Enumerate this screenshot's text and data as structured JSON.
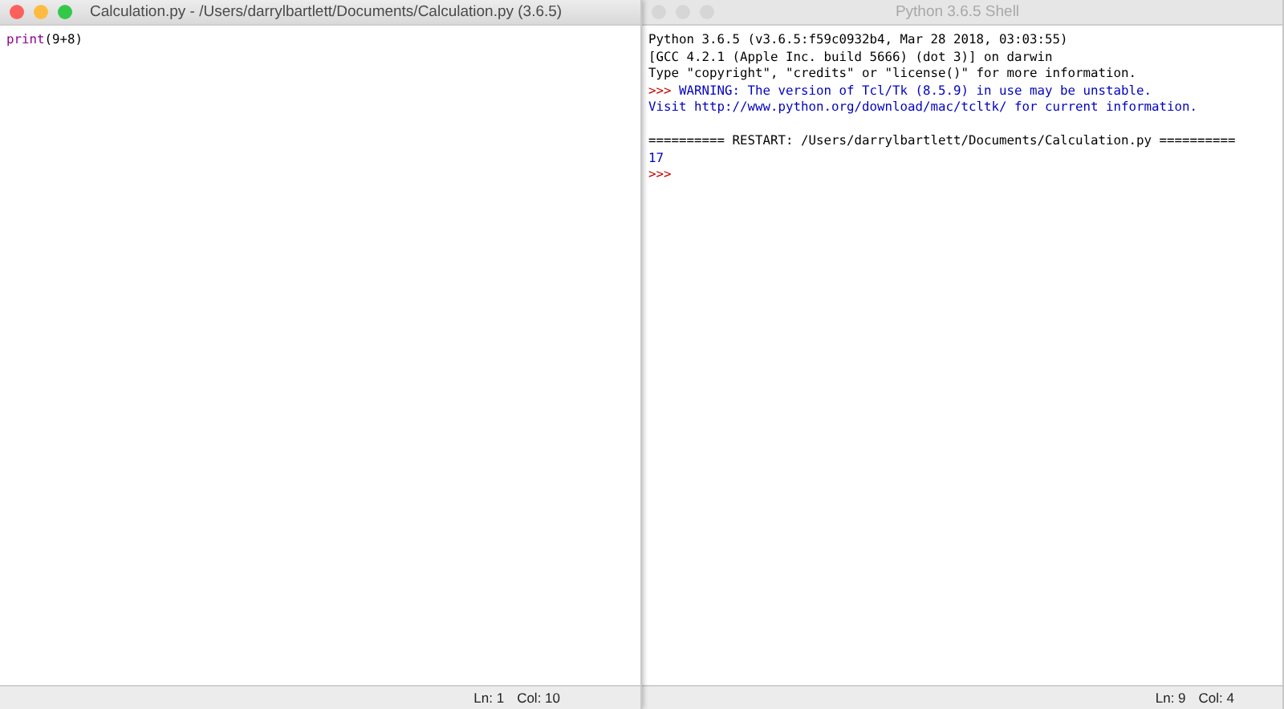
{
  "editor": {
    "title": "Calculation.py - /Users/darrylbartlett/Documents/Calculation.py (3.6.5)",
    "active": true,
    "lines": [
      [
        {
          "text": "print",
          "kind": "builtin"
        },
        {
          "text": "(9+8)",
          "kind": "plain"
        }
      ]
    ],
    "status": [
      "Ln: 1",
      "Col: 10"
    ]
  },
  "shell": {
    "title": "Python 3.6.5 Shell",
    "active": false,
    "lines": [
      {
        "gap_before": false,
        "segments": [
          {
            "text": "Python 3.6.5 (v3.6.5:f59c0932b4, Mar 28 2018, 03:03:55)",
            "kind": "plain"
          }
        ]
      },
      {
        "gap_before": false,
        "segments": [
          {
            "text": "[GCC 4.2.1 (Apple Inc. build 5666) (dot 3)] on darwin",
            "kind": "plain"
          }
        ]
      },
      {
        "gap_before": false,
        "segments": [
          {
            "text": "Type \"copyright\", \"credits\" or \"license()\" for more information.",
            "kind": "plain"
          }
        ]
      },
      {
        "gap_before": false,
        "segments": [
          {
            "text": ">>>",
            "kind": "prompt"
          },
          {
            "text": " WARNING: The version of Tcl/Tk (8.5.9) in use may be unstable.",
            "kind": "output"
          }
        ]
      },
      {
        "gap_before": false,
        "segments": [
          {
            "text": "Visit http://www.python.org/download/mac/tcltk/ for current information.",
            "kind": "output"
          }
        ]
      },
      {
        "gap_before": true,
        "segments": [
          {
            "text": "========== RESTART: /Users/darrylbartlett/Documents/Calculation.py ==========",
            "kind": "plain"
          }
        ]
      },
      {
        "gap_before": false,
        "segments": [
          {
            "text": "17",
            "kind": "output"
          }
        ]
      },
      {
        "gap_before": false,
        "segments": [
          {
            "text": ">>>",
            "kind": "prompt"
          }
        ]
      }
    ],
    "status": [
      "Ln: 9",
      "Col: 4"
    ]
  }
}
